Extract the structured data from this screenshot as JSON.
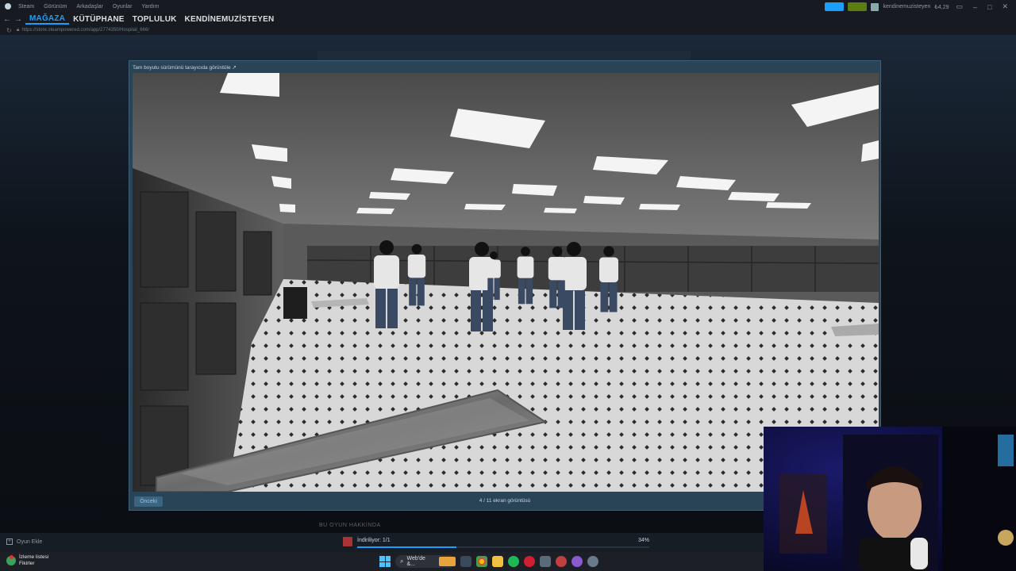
{
  "menubar": {
    "items": [
      "Steam",
      "Görünüm",
      "Arkadaşlar",
      "Oyunlar",
      "Yardım"
    ],
    "username": "kendinemuzisteyen",
    "balance": "₺4,29"
  },
  "nav": {
    "tabs": [
      "MAĞAZA",
      "KÜTÜPHANE",
      "TOPLULUK",
      "KENDİNEMUZİSTEYEN"
    ],
    "active_index": 0,
    "url": "https://store.steampowered.com/app/2774350/Hospital_666/"
  },
  "store": {
    "about_label": "BU OYUN HAKKINDA"
  },
  "modal": {
    "header": "Tam boyutu sürümünü tarayıcıda görüntüle ↗",
    "prev_label": "Önceki",
    "counter": "4 / 11 ekran görüntüsü"
  },
  "bottombar": {
    "add_game": "Oyun Ekle",
    "download_label": "İndiriliyor: 1/1",
    "download_percent_text": "34%",
    "download_progress": 0.34
  },
  "taskbar": {
    "weather_line1": "İzleme listesi",
    "weather_line2": "Fikirler",
    "search_placeholder": "Web'de &..."
  },
  "colors": {
    "accent": "#1a9fff",
    "modal_bg": "#2a4457",
    "steam_dark": "#171a21"
  }
}
